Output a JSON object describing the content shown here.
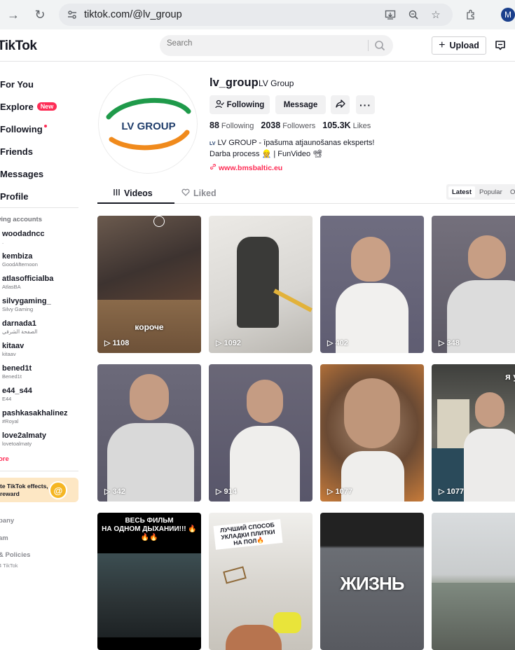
{
  "browser": {
    "url": "tiktok.com/@lv_group",
    "profile_initial": "M"
  },
  "topnav": {
    "logo": "TikTok",
    "search_placeholder": "Search",
    "upload_label": "Upload"
  },
  "sidebar": {
    "items": [
      {
        "label": "For You",
        "icon": "home-icon"
      },
      {
        "label": "Explore",
        "icon": "compass-icon",
        "badge": "New"
      },
      {
        "label": "Following",
        "icon": "users-icon"
      },
      {
        "label": "Friends",
        "icon": "friends-icon"
      },
      {
        "label": "Messages",
        "icon": "message-icon"
      },
      {
        "label": "Profile",
        "icon": "profile-icon"
      }
    ],
    "accounts_heading": "wing accounts",
    "accounts": [
      {
        "user": "woodadncc",
        "name": "."
      },
      {
        "user": "kembiza",
        "name": "GoodAfternoon"
      },
      {
        "user": "atlasofficialba",
        "name": "AtlasBA"
      },
      {
        "user": "silvygaming_",
        "name": "Silvy Gaming"
      },
      {
        "user": "darnada1",
        "name": "الصفحة الشرقي"
      },
      {
        "user": "kitaav",
        "name": "kitaav"
      },
      {
        "user": "bened1t",
        "name": "Bened1t"
      },
      {
        "user": "e44_s44",
        "name": "E44"
      },
      {
        "user": "pashkasakhalinez",
        "name": "#Royal"
      },
      {
        "user": "love2almaty",
        "name": "lovetoalmaty"
      }
    ],
    "see_more": "ore",
    "effects_line1": "te TikTok effects,",
    "effects_line2": "reward",
    "footer": [
      "pany",
      "am",
      "& Policies",
      "4 TikTok"
    ]
  },
  "profile": {
    "username": "lv_group",
    "nickname": "LV Group",
    "following_btn": "Following",
    "message_btn": "Message",
    "following_count": "88",
    "following_label": "Following",
    "followers_count": "2038",
    "followers_label": "Followers",
    "likes_count": "105.3K",
    "likes_label": "Likes",
    "bio_line1": "LV GROUP - īpašuma atjaunošanas eksperts!",
    "bio_line2": "Darba process 👷 | FunVideo 📽",
    "link": "www.bmsbaltic.eu",
    "logo_text": "LV GROUP"
  },
  "tabs": {
    "videos": "Videos",
    "liked": "Liked",
    "sort": [
      "Latest",
      "Popular",
      "O"
    ]
  },
  "videos": [
    {
      "views": "1108",
      "caption": "короче"
    },
    {
      "views": "1092",
      "caption": ""
    },
    {
      "views": "402",
      "caption": ""
    },
    {
      "views": "348",
      "caption": ""
    },
    {
      "views": "342",
      "caption": ""
    },
    {
      "views": "914",
      "caption": ""
    },
    {
      "views": "1077",
      "caption": ""
    },
    {
      "views": "1077",
      "caption": "я уже"
    },
    {
      "views": "",
      "caption": "ВЕСЬ ФИЛЬМ\nНА ОДНОМ ДЫХАНИИ!!! 🔥🔥🔥"
    },
    {
      "views": "",
      "caption": "ЛУЧШИЙ СПОСОБ УКЛАДКИ ПЛИТКИ НА ПОЛ🔥"
    },
    {
      "views": "",
      "caption": "ЖИЗНЬ"
    },
    {
      "views": "",
      "caption": ""
    }
  ],
  "colors": {
    "accent": "#fe2c55",
    "logo_green": "#1f9a4a",
    "logo_orange": "#f08a1c",
    "logo_text": "#1f3d6b"
  }
}
